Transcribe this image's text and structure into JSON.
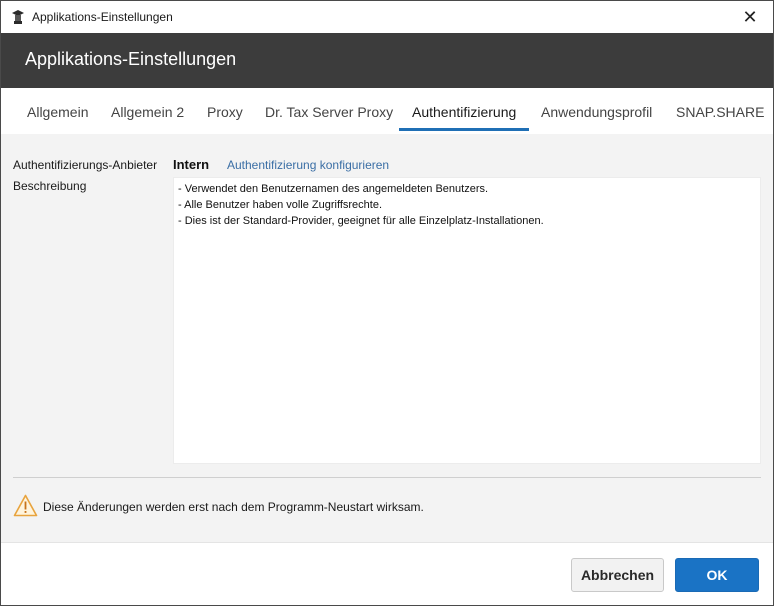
{
  "window": {
    "title": "Applikations-Einstellungen",
    "close_glyph": "✕"
  },
  "header": {
    "title": "Applikations-Einstellungen"
  },
  "tabs": [
    {
      "label": "Allgemein"
    },
    {
      "label": "Allgemein 2"
    },
    {
      "label": "Proxy"
    },
    {
      "label": "Dr. Tax Server Proxy"
    },
    {
      "label": "Authentifizierung",
      "active": true
    },
    {
      "label": "Anwendungsprofil"
    },
    {
      "label": "SNAP.SHARE"
    }
  ],
  "auth": {
    "provider_label": "Authentifizierungs-Anbieter",
    "provider_value": "Intern",
    "configure_link": "Authentifizierung konfigurieren",
    "description_label": "Beschreibung",
    "description_lines": [
      "- Verwendet den Benutzernamen des angemeldeten Benutzers.",
      "- Alle Benutzer haben volle Zugriffsrechte.",
      "- Dies ist der Standard-Provider, geeignet für alle Einzelplatz-Installationen."
    ]
  },
  "notice": {
    "text": "Diese Änderungen werden erst nach dem Programm-Neustart wirksam.",
    "icon": "warning-icon"
  },
  "footer": {
    "cancel_label": "Abbrechen",
    "ok_label": "OK"
  },
  "colors": {
    "header_bg": "#3c3c3c",
    "accent": "#1a73c5",
    "link": "#3a6ea5",
    "warning": "#e8a33d"
  }
}
